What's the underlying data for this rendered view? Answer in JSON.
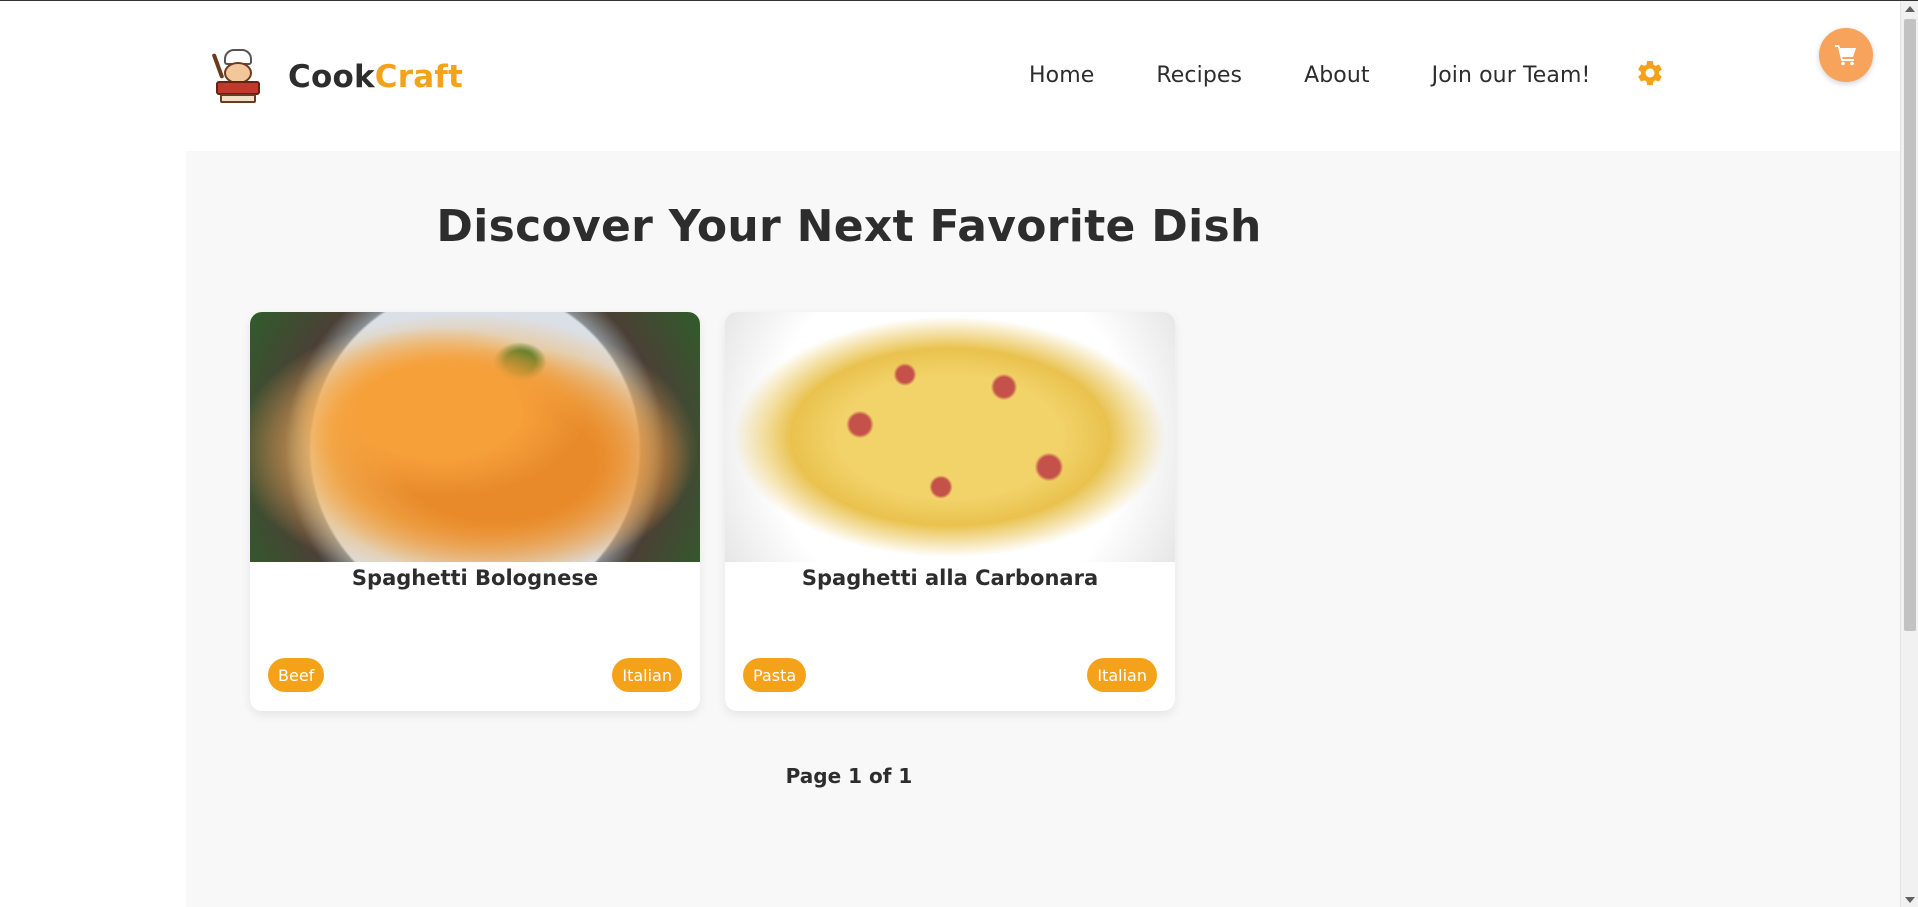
{
  "header": {
    "brand_part1": "Cook",
    "brand_part2": "Craft",
    "nav": {
      "home": "Home",
      "recipes": "Recipes",
      "about": "About",
      "join": "Join our Team!"
    },
    "settings_icon": "gear-icon",
    "cart_icon": "cart-icon"
  },
  "main": {
    "title": "Discover Your Next Favorite Dish",
    "cards": [
      {
        "title": "Spaghetti Bolognese",
        "tag_left": "Beef",
        "tag_right": "Italian"
      },
      {
        "title": "Spaghetti alla Carbonara",
        "tag_left": "Pasta",
        "tag_right": "Italian"
      }
    ],
    "pagination": "Page 1 of 1"
  },
  "colors": {
    "accent": "#f5a21b",
    "cart_button": "#f7a35c",
    "text": "#2d2d2d",
    "background": "#f8f8f8"
  }
}
